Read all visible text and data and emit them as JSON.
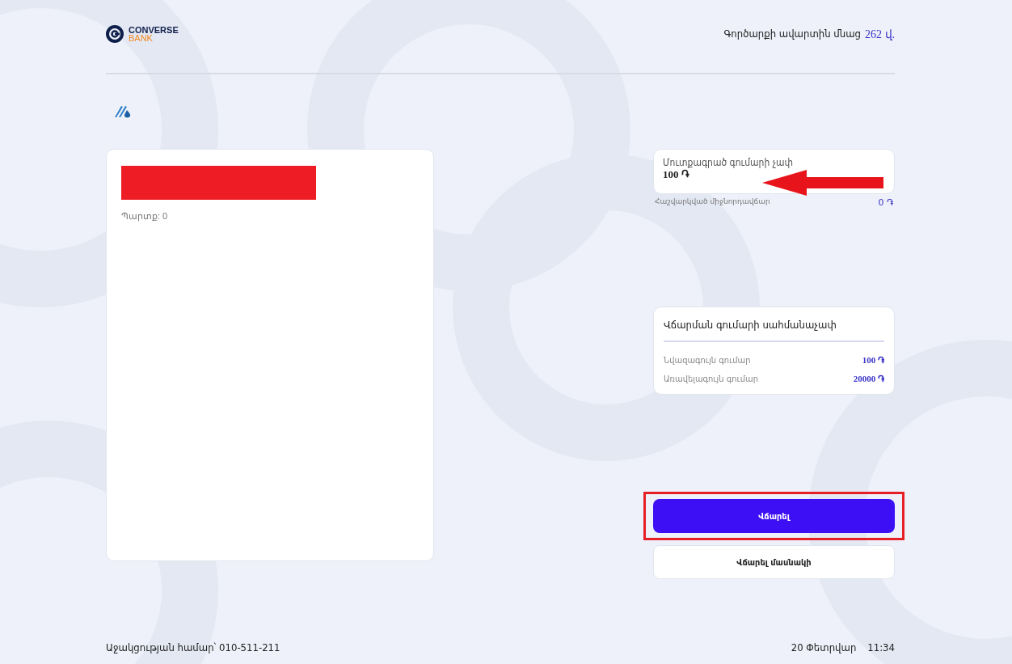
{
  "header": {
    "logo": {
      "name": "CONVERSE",
      "sub": "BANK"
    },
    "timer": {
      "label": "Գործարքի ավարտին մնաց",
      "value": "262 վ."
    }
  },
  "debt": {
    "redacted": true,
    "text": "Պարտք: 0"
  },
  "amount": {
    "label": "Մուտքագրած գումարի չափ",
    "value": "100 ֏",
    "arrow": true,
    "fee_label": "Հաշվարկված միջնորդավճար",
    "fee_value": "0 ֏"
  },
  "limits": {
    "title": "Վճարման գումարի սահմանաչափ",
    "rows": [
      {
        "label": "Նվազագույն գումար",
        "value": "100 ֏"
      },
      {
        "label": "Առավելագույն գումար",
        "value": "20000 ֏"
      }
    ]
  },
  "buttons": [
    {
      "label": "Վճարել",
      "kind": "primary",
      "highlighted": true
    },
    {
      "label": "Վճարել մասնակի",
      "kind": "secondary",
      "highlighted": false
    }
  ],
  "footer": {
    "support": "Աջակցության համար՝ 010-511-211",
    "date": "20 Փետրվար",
    "time": "11:34"
  }
}
